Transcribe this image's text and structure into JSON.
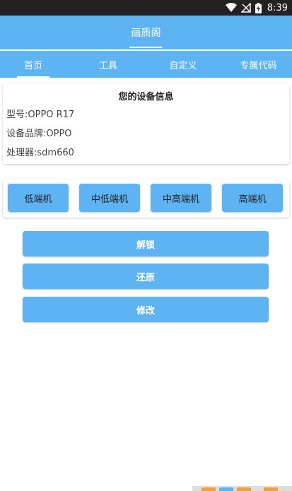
{
  "status_bar": {
    "time": "8:39",
    "icons": [
      "wifi-icon",
      "signal-icon",
      "battery-charging-icon"
    ]
  },
  "app_bar": {
    "title": "画质阁"
  },
  "tabs": [
    {
      "label": "首页",
      "selected": true
    },
    {
      "label": "工具",
      "selected": false
    },
    {
      "label": "自定义",
      "selected": false
    },
    {
      "label": "专属代码",
      "selected": false
    }
  ],
  "device_info": {
    "title": "您的设备信息",
    "model": "型号:OPPO R17",
    "brand": "设备品牌:OPPO",
    "processor": "处理器:sdm660"
  },
  "tiers": [
    {
      "label": "低端机"
    },
    {
      "label": "中低端机"
    },
    {
      "label": "中高端机"
    },
    {
      "label": "高端机"
    }
  ],
  "actions": {
    "unlock": "解锁",
    "restore": "还原",
    "modify": "修改"
  },
  "colors": {
    "accent": "#5eb3f2",
    "status_bar": "#222222",
    "card_bg": "#ffffff"
  }
}
